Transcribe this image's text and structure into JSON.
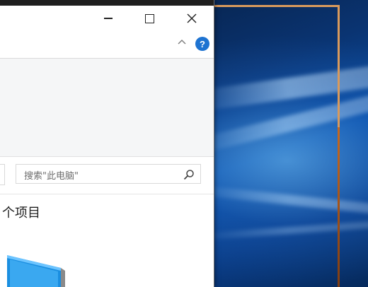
{
  "window": {
    "minimize_icon": "minimize-icon",
    "maximize_icon": "maximize-icon",
    "close_icon": "close-icon",
    "collapse_ribbon_icon": "chevron-up-icon",
    "help_label": "?"
  },
  "search": {
    "placeholder": "搜索\"此电脑\""
  },
  "content": {
    "item_count_text": "个项目"
  },
  "colors": {
    "help_accent": "#1e73d1",
    "frame_border": "#d99a5c"
  }
}
